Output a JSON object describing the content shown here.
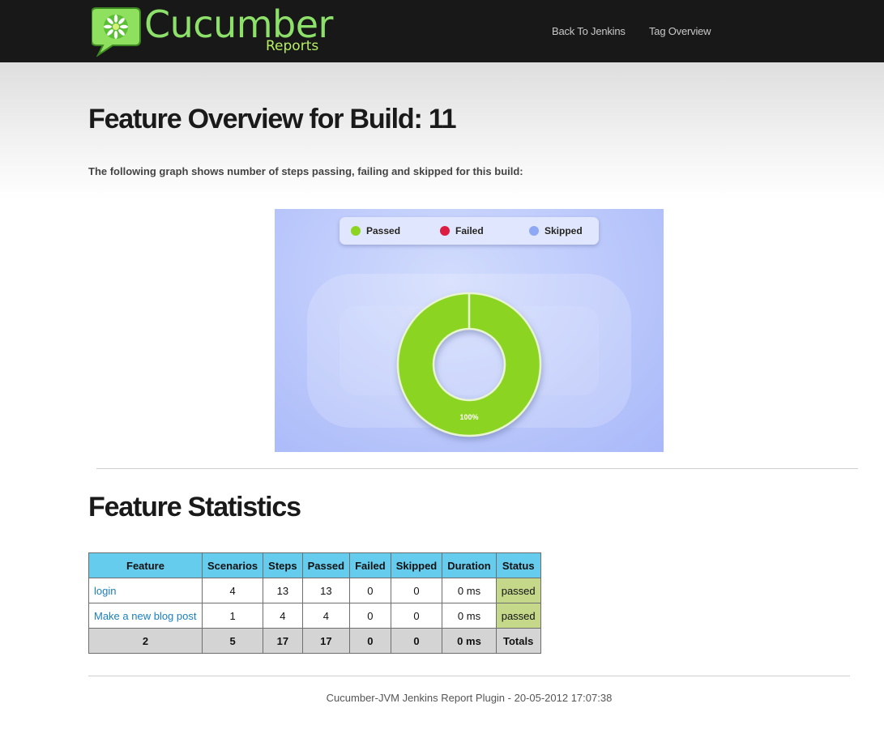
{
  "header": {
    "logo_word": "Cucumber",
    "logo_sub": "Reports",
    "nav": [
      {
        "label": "Back To Jenkins"
      },
      {
        "label": "Tag Overview"
      }
    ]
  },
  "page": {
    "title": "Feature Overview for Build: 11",
    "intro": "The following graph shows number of steps passing, failing and skipped for this build:"
  },
  "chart_data": {
    "type": "pie",
    "donut": true,
    "categories": [
      "Passed",
      "Failed",
      "Skipped"
    ],
    "values": [
      17,
      0,
      0
    ],
    "data_labels": [
      "100%"
    ],
    "colors": [
      "#8cd420",
      "#dc1c40",
      "#8fa8f5"
    ],
    "legend": "top-center"
  },
  "stats": {
    "title": "Feature Statistics",
    "columns": [
      "Feature",
      "Scenarios",
      "Steps",
      "Passed",
      "Failed",
      "Skipped",
      "Duration",
      "Status"
    ],
    "rows": [
      {
        "feature": "login",
        "scenarios": "4",
        "steps": "13",
        "passed": "13",
        "failed": "0",
        "skipped": "0",
        "duration": "0 ms",
        "status": "passed"
      },
      {
        "feature": "Make a new blog post",
        "scenarios": "1",
        "steps": "4",
        "passed": "4",
        "failed": "0",
        "skipped": "0",
        "duration": "0 ms",
        "status": "passed"
      }
    ],
    "totals": {
      "feature": "2",
      "scenarios": "5",
      "steps": "17",
      "passed": "17",
      "failed": "0",
      "skipped": "0",
      "duration": "0 ms",
      "status": "Totals"
    }
  },
  "footer": {
    "text": "Cucumber-JVM Jenkins Report Plugin - 20-05-2012 17:07:38"
  },
  "colors": {
    "topbar": "#181818",
    "table_header": "#66ccee",
    "status_passed": "#c5d88a",
    "link": "#1a7fc0"
  }
}
